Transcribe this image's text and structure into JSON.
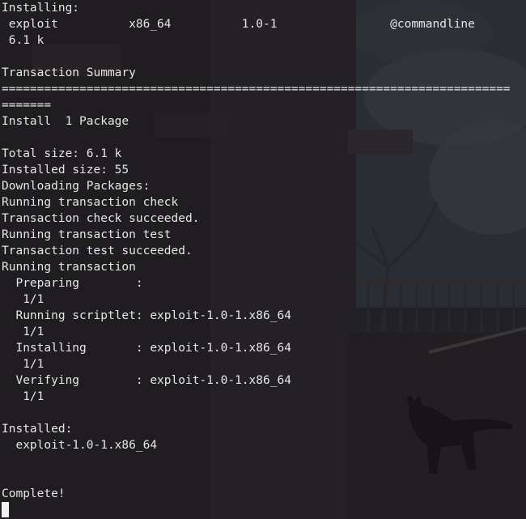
{
  "terminal": {
    "lines": [
      "Installing:",
      " exploit          x86_64          1.0-1                @commandline",
      " 6.1 k",
      "",
      "Transaction Summary",
      "========================================================================",
      "=======",
      "Install  1 Package",
      "",
      "Total size: 6.1 k",
      "Installed size: 55",
      "Downloading Packages:",
      "Running transaction check",
      "Transaction check succeeded.",
      "Running transaction test",
      "Transaction test succeeded.",
      "Running transaction",
      "  Preparing        :",
      "   1/1",
      "  Running scriptlet: exploit-1.0-1.x86_64",
      "   1/1",
      "  Installing       : exploit-1.0-1.x86_64",
      "   1/1",
      "  Verifying        : exploit-1.0-1.x86_64",
      "   1/1",
      "",
      "Installed:",
      "  exploit-1.0-1.x86_64",
      "",
      "",
      "Complete!"
    ]
  },
  "colors": {
    "text": "#e6e6e6",
    "background": "#1d1c1f",
    "cursor": "#f0f0f0"
  },
  "icons": {
    "cursor": "block-cursor-icon"
  }
}
